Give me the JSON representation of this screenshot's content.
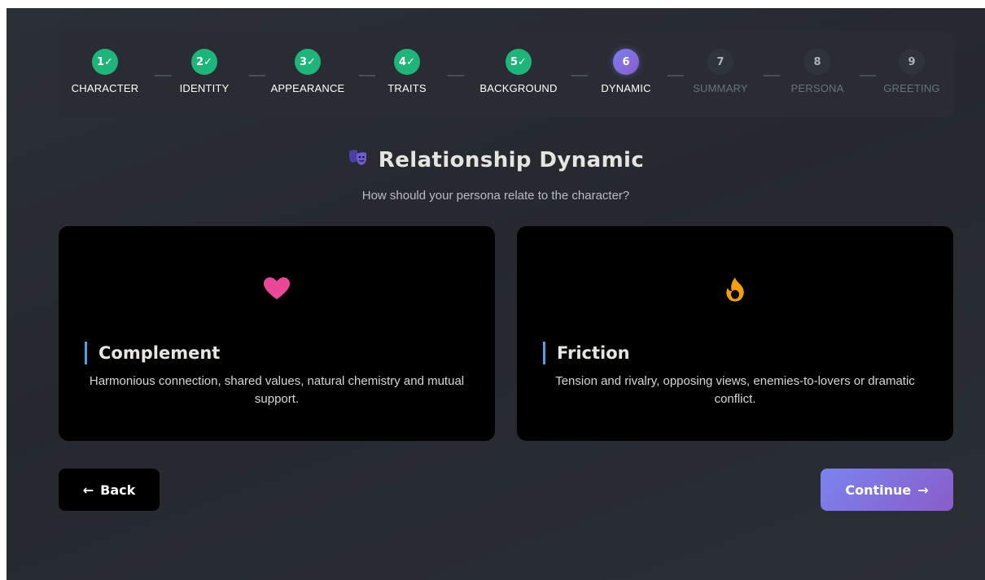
{
  "stepper": {
    "steps": [
      {
        "number": "1✓",
        "label": "CHARACTER",
        "state": "done"
      },
      {
        "number": "2✓",
        "label": "IDENTITY",
        "state": "done"
      },
      {
        "number": "3✓",
        "label": "APPEARANCE",
        "state": "done"
      },
      {
        "number": "4✓",
        "label": "TRAITS",
        "state": "done"
      },
      {
        "number": "5✓",
        "label": "BACKGROUND",
        "state": "done"
      },
      {
        "number": "6",
        "label": "DYNAMIC",
        "state": "active"
      },
      {
        "number": "7",
        "label": "SUMMARY",
        "state": "todo"
      },
      {
        "number": "8",
        "label": "PERSONA",
        "state": "todo"
      },
      {
        "number": "9",
        "label": "GREETING",
        "state": "todo"
      }
    ]
  },
  "header": {
    "icon": "theater-masks-icon",
    "title": "Relationship Dynamic",
    "subtitle": "How should your persona relate to the character?"
  },
  "options": [
    {
      "icon": "heart-icon",
      "icon_color": "#ec4899",
      "title": "Complement",
      "description": "Harmonious connection, shared values, natural chemistry and mutual support."
    },
    {
      "icon": "fire-icon",
      "icon_color": "#f59e0b",
      "title": "Friction",
      "description": "Tension and rivalry, opposing views, enemies-to-lovers or dramatic conflict."
    }
  ],
  "navigation": {
    "back_label": "Back",
    "back_icon": "arrow-left-icon",
    "continue_label": "Continue",
    "continue_icon": "arrow-right-icon"
  },
  "colors": {
    "done": "#1fb57a",
    "active_start": "#7b7ff0",
    "active_end": "#8a5cc9",
    "accent_bar": "#4aa3e8"
  }
}
